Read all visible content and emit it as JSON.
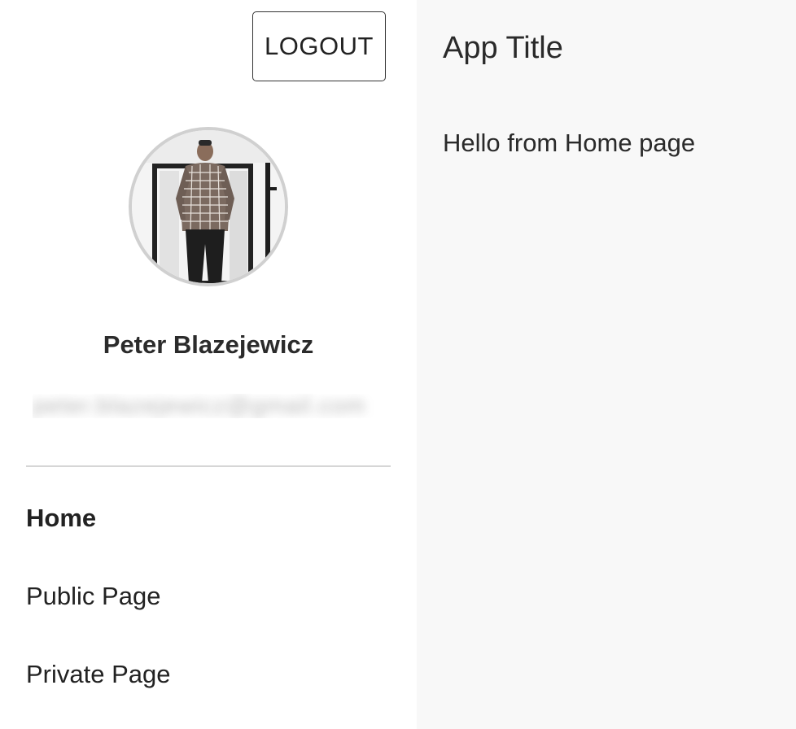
{
  "header": {
    "logout_label": "LOGOUT",
    "app_title": "App Title"
  },
  "profile": {
    "name": "Peter Blazejewicz",
    "email": "peter.blazejewicz@gmail.com",
    "avatar_icon": "user-photo"
  },
  "nav": {
    "items": [
      {
        "label": "Home",
        "active": true
      },
      {
        "label": "Public Page",
        "active": false
      },
      {
        "label": "Private Page",
        "active": false
      }
    ]
  },
  "main": {
    "message": "Hello from Home page"
  },
  "colors": {
    "sidebar_bg": "#ffffff",
    "main_bg": "#f8f8f8",
    "divider": "#d6d6d6",
    "avatar_border": "#d0d0d0",
    "text": "#212121"
  }
}
